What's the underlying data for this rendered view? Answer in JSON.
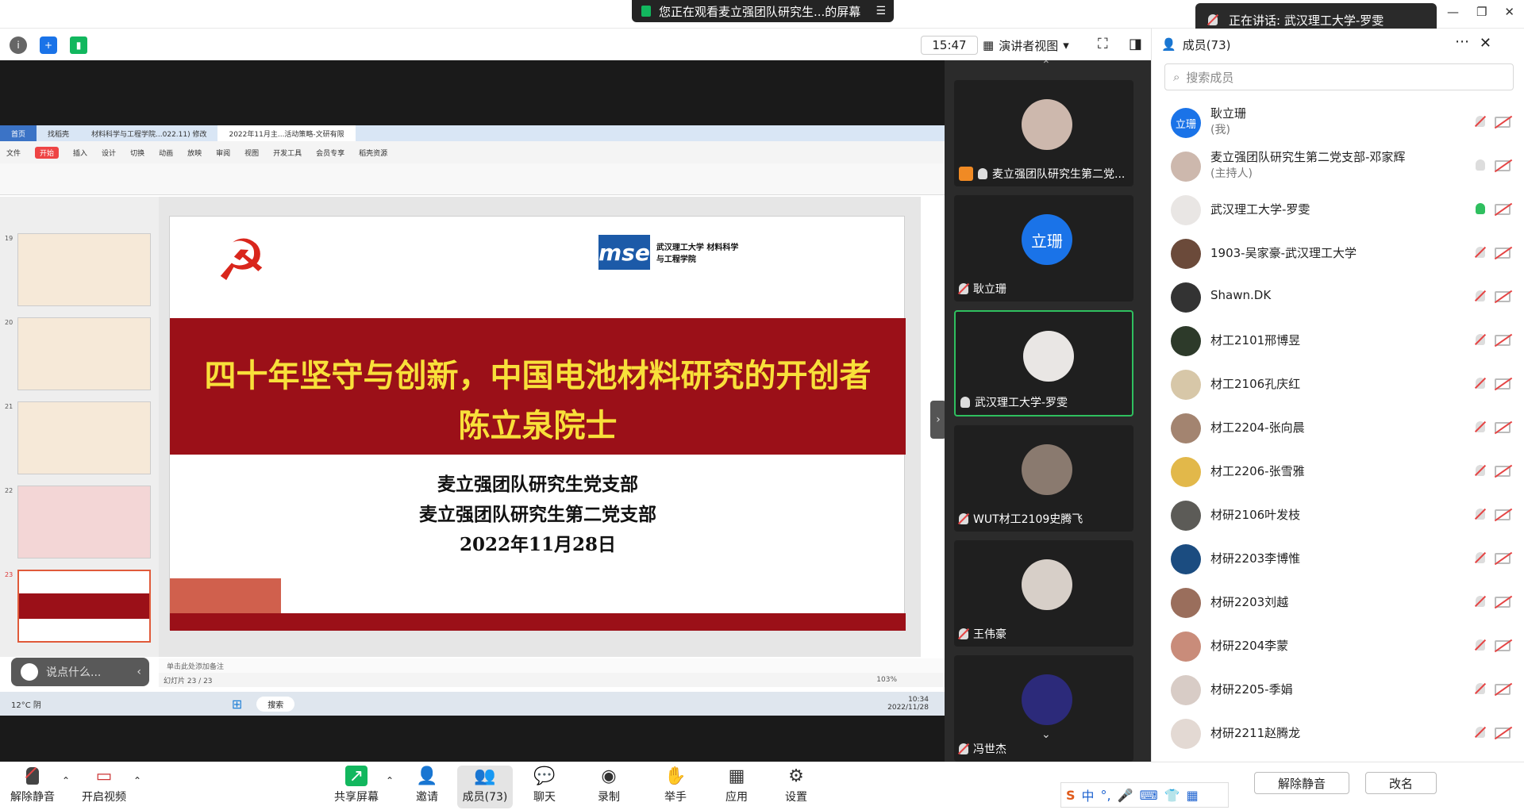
{
  "window": {
    "share_banner": "您正在观看麦立强团队研究生...的屏幕",
    "speaking": "正在讲话: 武汉理工大学-罗雯"
  },
  "toolbar": {
    "time": "15:47",
    "view_label": "演讲者视图"
  },
  "slide": {
    "title": "四十年坚守与创新，中国电池材料研究的开创者",
    "name": "陈立泉院士",
    "line1": "麦立强团队研究生党支部",
    "line2": "麦立强团队研究生第二党支部",
    "date": "2022年11月28日",
    "logo_text": "武汉理工大学 材料科学与工程学院"
  },
  "wps": {
    "tabs": [
      "首页",
      "找稻壳",
      "材料科学与工程学院...022.11) 修改",
      "2022年11月主...活动策略-文研有限"
    ],
    "menu": [
      "文件",
      "开始",
      "插入",
      "设计",
      "切换",
      "动画",
      "放映",
      "审阅",
      "视图",
      "开发工具",
      "会员专享",
      "稻壳资源"
    ],
    "slide_nums": [
      "19",
      "20",
      "21",
      "22",
      "23"
    ],
    "notes_hint": "单击此处添加备注",
    "zoom": "103%",
    "status_left": "幻灯片 23 / 23",
    "weather": "12°C 阴",
    "taskbar_search": "搜索",
    "taskbar_time": "10:34",
    "taskbar_date": "2022/11/28"
  },
  "chat_bubble": "说点什么...",
  "video_tiles": [
    {
      "name": "麦立强团队研究生第二党...",
      "avatar": ""
    },
    {
      "name": "耿立珊",
      "avatar": "立珊"
    },
    {
      "name": "武汉理工大学-罗雯",
      "avatar": ""
    },
    {
      "name": "WUT材工2109史腾飞",
      "avatar": ""
    },
    {
      "name": "王伟豪",
      "avatar": ""
    },
    {
      "name": "冯世杰",
      "avatar": ""
    }
  ],
  "members": {
    "header": "成员(73)",
    "search_placeholder": "搜索成员",
    "list": [
      {
        "name": "耿立珊",
        "sub": "(我)",
        "avatar": "立珊"
      },
      {
        "name": "麦立强团队研究生第二党支部-邓家辉",
        "sub": "(主持人)",
        "avatar": ""
      },
      {
        "name": "武汉理工大学-罗雯",
        "sub": "",
        "avatar": ""
      },
      {
        "name": "1903-吴家豪-武汉理工大学",
        "sub": "",
        "avatar": ""
      },
      {
        "name": "Shawn.DK",
        "sub": "",
        "avatar": ""
      },
      {
        "name": "材工2101邢博昱",
        "sub": "",
        "avatar": ""
      },
      {
        "name": "材工2106孔庆红",
        "sub": "",
        "avatar": ""
      },
      {
        "name": "材工2204-张向晨",
        "sub": "",
        "avatar": ""
      },
      {
        "name": "材工2206-张雪雅",
        "sub": "",
        "avatar": ""
      },
      {
        "name": "材研2106叶发枝",
        "sub": "",
        "avatar": ""
      },
      {
        "name": "材研2203李博惟",
        "sub": "",
        "avatar": ""
      },
      {
        "name": "材研2203刘越",
        "sub": "",
        "avatar": ""
      },
      {
        "name": "材研2204李蒙",
        "sub": "",
        "avatar": ""
      },
      {
        "name": "材研2205-季娟",
        "sub": "",
        "avatar": ""
      },
      {
        "name": "材研2211赵腾龙",
        "sub": "",
        "avatar": ""
      }
    ],
    "unmute_all": "解除静音",
    "rename": "改名"
  },
  "bottom": {
    "unmute": "解除静音",
    "video": "开启视频",
    "share": "共享屏幕",
    "invite": "邀请",
    "members": "成员(73)",
    "chat": "聊天",
    "record": "录制",
    "raise": "举手",
    "apps": "应用",
    "settings": "设置"
  },
  "ime": {
    "lang": "中"
  },
  "colors": {
    "red": "#9b1018",
    "yellow": "#f8e03a",
    "green": "#2fbf5f",
    "blue": "#1a73e8"
  }
}
